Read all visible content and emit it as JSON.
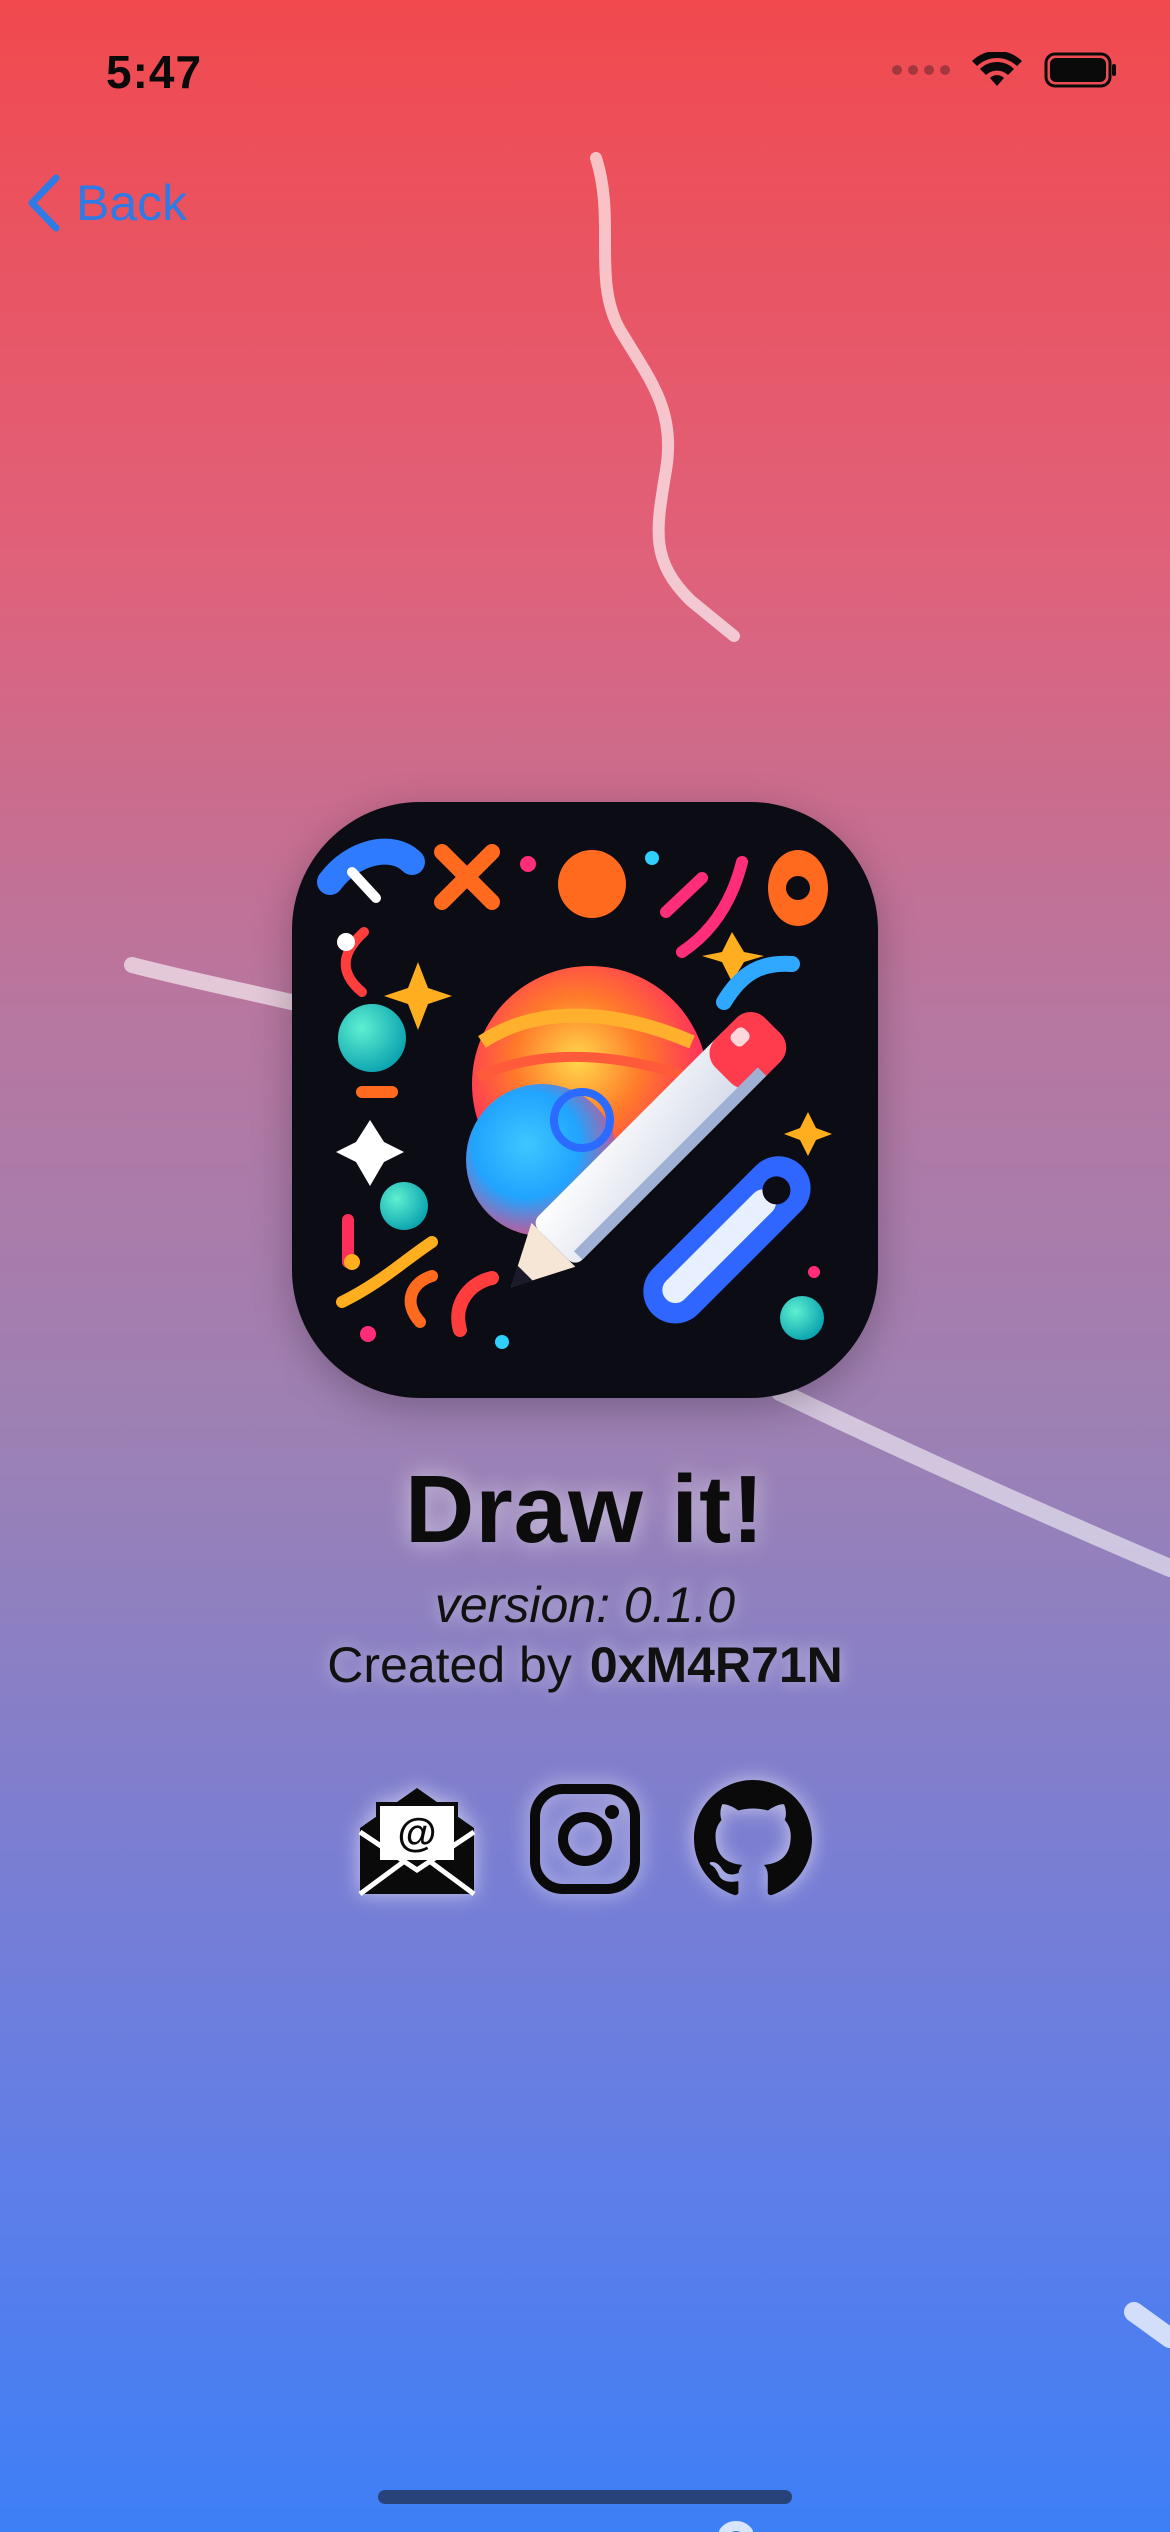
{
  "status_bar": {
    "time": "5:47"
  },
  "navigation": {
    "back_label": "Back"
  },
  "app": {
    "name": "Draw it!",
    "version_text": "version: 0.1.0",
    "created_by_label": "Created by",
    "author": "0xM4R71N"
  },
  "social_links": [
    {
      "name": "email",
      "icon": "mail-at-icon"
    },
    {
      "name": "instagram",
      "icon": "instagram-icon"
    },
    {
      "name": "github",
      "icon": "github-icon"
    }
  ],
  "colors": {
    "accent": "#2f7ae4",
    "gradient_top": "#f1494e",
    "gradient_bottom": "#3d7ff6",
    "text": "#111111"
  }
}
